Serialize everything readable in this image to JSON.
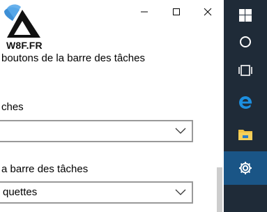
{
  "window": {
    "heading": "boutons de la barre des tâches",
    "controls": {
      "minimize": "minimize",
      "maximize": "maximize",
      "close": "close"
    }
  },
  "logo": {
    "text": "W8F.FR"
  },
  "settings": {
    "label_1": "ches",
    "dropdown_1_value": "",
    "label_2": "a barre des tâches",
    "dropdown_2_value": "quettes"
  },
  "taskbar": {
    "items": [
      "windows-logo",
      "cortana-circle",
      "task-view",
      "edge-browser",
      "file-explorer",
      "settings-gear"
    ],
    "active_item": "settings-gear",
    "accent": "#1a5586",
    "background": "#1f2b38"
  },
  "colors": {
    "edge_blue": "#1c8fe0",
    "folder_yellow": "#f0c244",
    "dropdown_border": "#999999"
  }
}
